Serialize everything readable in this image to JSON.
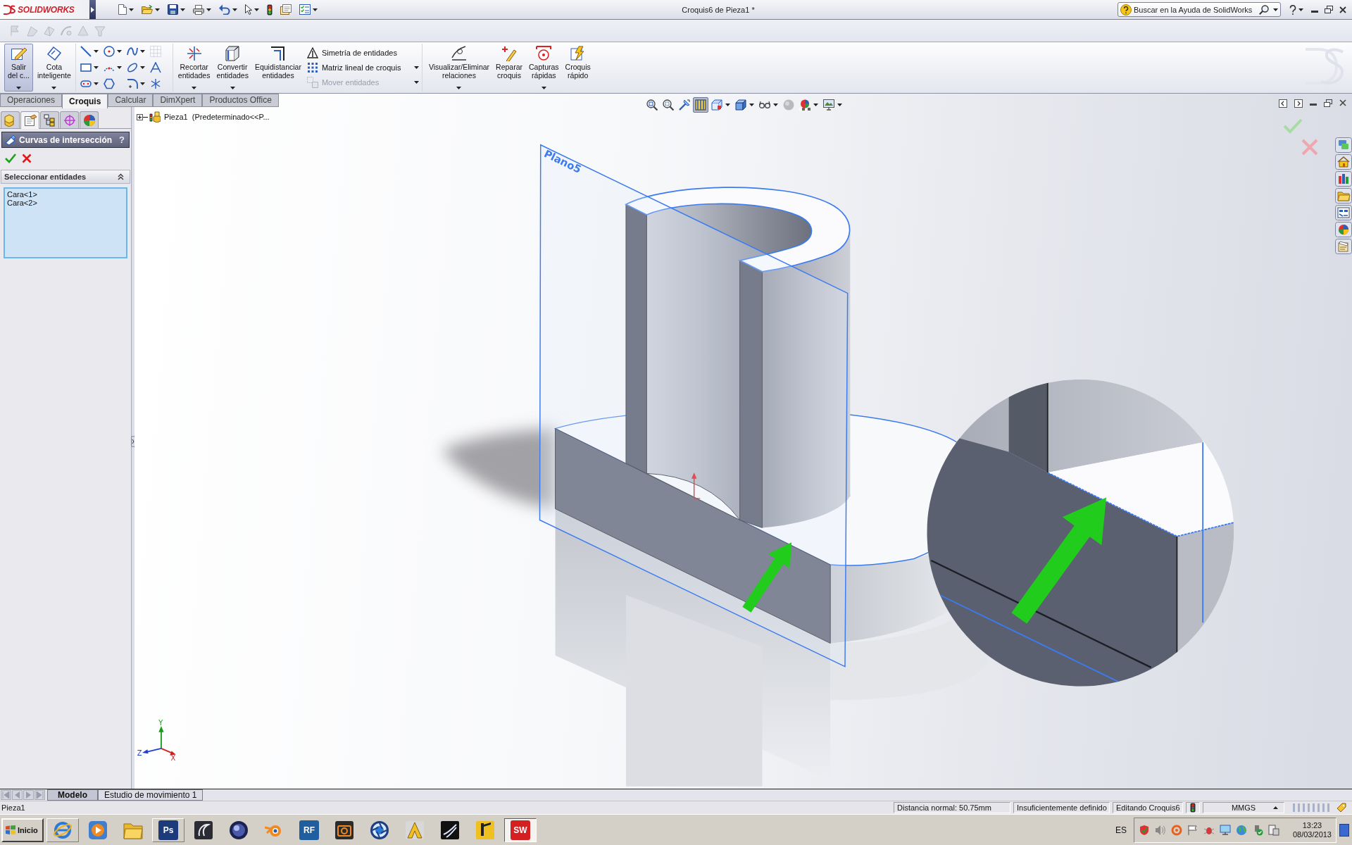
{
  "window": {
    "logo": "SOLIDWORKS",
    "title": "Croquis6 de Pieza1 *"
  },
  "quick_access": [
    {
      "dropdown": true
    },
    {
      "dropdown": true
    },
    {
      "dropdown": true
    },
    {
      "dropdown": true
    },
    {
      "dropdown": true
    },
    {
      "dropdown": true
    },
    {
      "dropdown": false
    },
    {
      "dropdown": false
    },
    {
      "dropdown": true
    }
  ],
  "help_search": {
    "placeholder": "Buscar en la Ayuda de SolidWorks"
  },
  "toolbar": [
    {
      "disabled": true
    },
    {
      "disabled": true
    },
    {
      "disabled": true
    },
    {
      "disabled": true
    },
    {
      "disabled": true
    },
    {
      "disabled": true
    }
  ],
  "ribbon": [
    {
      "kind": "big",
      "label": "Salir del c...",
      "selected": true,
      "dropdown": true
    },
    {
      "kind": "big",
      "label": "Cota inteligente",
      "selected": false,
      "dropdown": true
    },
    {
      "kind": "tools",
      "tools": [
        {
          "dropdown": true,
          "disabled": false
        },
        {
          "dropdown": true,
          "disabled": false
        },
        {
          "dropdown": true,
          "disabled": false
        },
        {
          "dropdown": false,
          "disabled": true
        },
        {
          "dropdown": true,
          "disabled": false
        },
        {
          "dropdown": true,
          "disabled": false
        },
        {
          "dropdown": true,
          "disabled": false
        },
        {
          "dropdown": false,
          "disabled": false
        },
        {
          "dropdown": true,
          "disabled": false
        },
        {
          "dropdown": false,
          "disabled": false
        },
        {
          "dropdown": true,
          "disabled": false
        },
        {
          "dropdown": false,
          "disabled": false
        }
      ]
    },
    {
      "kind": "big",
      "label": "Recortar entidades",
      "selected": false,
      "dropdown": true
    },
    {
      "kind": "big",
      "label": "Convertir entidades",
      "selected": false,
      "dropdown": true
    },
    {
      "kind": "big",
      "label": "Equidistanciar entidades",
      "selected": false,
      "dropdown": false
    },
    {
      "kind": "list",
      "items": [
        {
          "label": "Simetría de entidades",
          "disabled": false,
          "dropdown": false
        },
        {
          "label": "Matriz lineal de croquis",
          "disabled": false,
          "dropdown": true
        },
        {
          "label": "Mover entidades",
          "disabled": true,
          "dropdown": true
        }
      ]
    },
    {
      "kind": "big",
      "label": "Visualizar/Eliminar relaciones",
      "selected": false,
      "dropdown": true
    },
    {
      "kind": "big",
      "label": "Reparar croquis",
      "selected": false,
      "dropdown": false
    },
    {
      "kind": "big",
      "label": "Capturas rápidas",
      "selected": false,
      "dropdown": true
    },
    {
      "kind": "big",
      "label": "Croquis rápido",
      "selected": false,
      "dropdown": false
    }
  ],
  "tabs": [
    {
      "label": "Operaciones",
      "selected": false
    },
    {
      "label": "Croquis",
      "selected": true
    },
    {
      "label": "Calcular",
      "selected": false
    },
    {
      "label": "DimXpert",
      "selected": false
    },
    {
      "label": "Productos Office",
      "selected": false
    }
  ],
  "panel_tabs": [
    {
      "selected": false
    },
    {
      "selected": true
    },
    {
      "selected": false
    },
    {
      "selected": false
    },
    {
      "selected": false
    }
  ],
  "property_manager": {
    "title": "Curvas de intersección",
    "help": "?",
    "group": {
      "title": "Seleccionar entidades",
      "expanded": true,
      "items": [
        "Cara<1>",
        "Cara<2>"
      ]
    }
  },
  "feature_tree": {
    "label": "Pieza1  (Predeterminado<<P...",
    "expanded": false
  },
  "view_toolbar": [
    {
      "selected": false,
      "dropdown": false
    },
    {
      "selected": false,
      "dropdown": false
    },
    {
      "selected": false,
      "dropdown": false
    },
    {
      "selected": true,
      "dropdown": false
    },
    {
      "selected": false,
      "dropdown": true
    },
    {
      "selected": false,
      "dropdown": true
    },
    {
      "selected": false,
      "dropdown": true
    },
    {
      "selected": false,
      "dropdown": false
    },
    {
      "selected": false,
      "dropdown": true
    },
    {
      "selected": false,
      "dropdown": true
    }
  ],
  "viewport": {
    "plane_label": "Plano5",
    "triad": {
      "x": "X",
      "y": "Y",
      "z": "Z"
    }
  },
  "bottom_tabs": [
    {
      "label": "Modelo",
      "selected": true
    },
    {
      "label": "Estudio de movimiento 1",
      "selected": false
    }
  ],
  "status_bar": {
    "document": "Pieza1",
    "fields": [
      "Distancia normal: 50.75mm",
      "Insuficientemente definido",
      "Editando Croquis6"
    ],
    "units": "MMGS"
  },
  "taskbar": {
    "start": "Inicio",
    "apps": [
      {
        "open": true,
        "selected": false
      },
      {
        "open": false,
        "selected": false
      },
      {
        "open": false,
        "selected": false
      },
      {
        "open": true,
        "selected": false,
        "label": "Ps"
      },
      {
        "open": false,
        "selected": false
      },
      {
        "open": false,
        "selected": false
      },
      {
        "open": false,
        "selected": false
      },
      {
        "open": false,
        "selected": false,
        "label": "RF"
      },
      {
        "open": false,
        "selected": false
      },
      {
        "open": false,
        "selected": false
      },
      {
        "open": false,
        "selected": false
      },
      {
        "open": false,
        "selected": false
      },
      {
        "open": false,
        "selected": false
      },
      {
        "open": true,
        "selected": true,
        "label": "SW"
      }
    ],
    "language": "ES",
    "clock": {
      "time": "13:23",
      "date": "08/03/2013"
    }
  }
}
